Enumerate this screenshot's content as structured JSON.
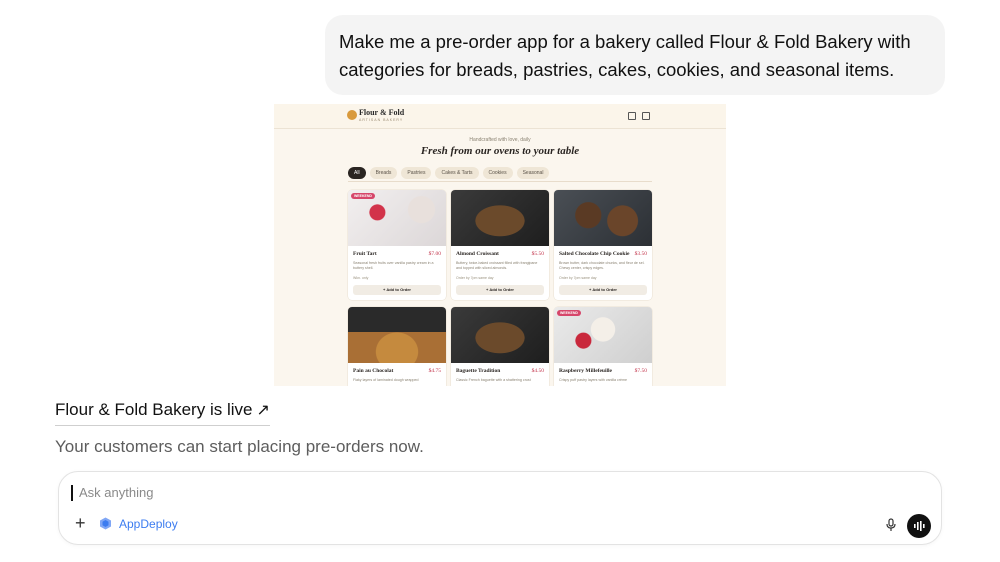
{
  "user_message": "Make me a pre-order app for a bakery called Flour & Fold Bakery with categories for breads, pastries, cakes, cookies, and seasonal items.",
  "preview": {
    "brand": "Flour & Fold",
    "tagline": "ARTISAN BAKERY",
    "subheading": "Handcrafted with love, daily",
    "headline": "Fresh from our ovens to your table",
    "tabs": [
      "All",
      "Breads",
      "Pastries",
      "Cakes & Tarts",
      "Cookies",
      "Seasonal"
    ],
    "active_tab": "All",
    "products": [
      {
        "name": "Fruit Tart",
        "price": "$7.00",
        "badge": "WEEKEND",
        "desc": "Seasonal fresh fruits over vanilla pastry cream in a buttery shell.",
        "meta": "Wkn. only",
        "button": "+ Add to Order"
      },
      {
        "name": "Almond Croissant",
        "price": "$5.50",
        "badge": "",
        "desc": "Buttery, twice-baked croissant filled with frangipane and topped with sliced almonds.",
        "meta": "Order by 7pm same day",
        "button": "+ Add to Order"
      },
      {
        "name": "Salted Chocolate Chip Cookie",
        "price": "$3.50",
        "badge": "",
        "desc": "Brown butter, dark chocolate chunks, and fleur de sel. Chewy center, crispy edges.",
        "meta": "Order by 7pm same day",
        "button": "+ Add to Order"
      },
      {
        "name": "Pain au Chocolat",
        "price": "$4.75",
        "badge": "",
        "desc": "Flaky layers of laminated dough wrapped",
        "meta": "",
        "button": ""
      },
      {
        "name": "Baguette Tradition",
        "price": "$4.50",
        "badge": "",
        "desc": "Classic French baguette with a shattering crust",
        "meta": "",
        "button": ""
      },
      {
        "name": "Raspberry Millefeuille",
        "price": "$7.50",
        "badge": "WEEKEND",
        "desc": "Crispy puff pastry layers with vanilla crème",
        "meta": "",
        "button": ""
      }
    ]
  },
  "response": {
    "live_link": "Flour & Fold Bakery is live",
    "followup": "Your customers can start placing pre-orders now."
  },
  "composer": {
    "placeholder": "Ask anything",
    "tool_label": "AppDeploy"
  },
  "icons": {
    "plus": "plus-icon",
    "appdeploy": "appdeploy-icon",
    "mic": "microphone-icon",
    "send": "voice-mode-icon",
    "arrow": "external-arrow-icon"
  },
  "colors": {
    "link_blue": "#3c7cf0",
    "bubble_bg": "#f4f4f4",
    "price_red": "#c2334a",
    "badge_pink": "#d6466a"
  }
}
